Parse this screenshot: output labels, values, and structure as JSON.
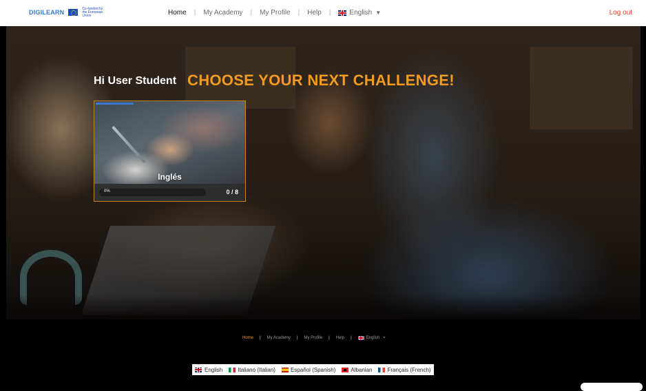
{
  "header": {
    "logo_text": "DIGILEARN",
    "eu_text": "Co-funded by the European Union",
    "nav": [
      {
        "label": "Home",
        "active": true
      },
      {
        "label": "My Academy",
        "active": false
      },
      {
        "label": "My Profile",
        "active": false
      },
      {
        "label": "Help",
        "active": false
      }
    ],
    "language": "English",
    "logout": "Log out"
  },
  "hero": {
    "greeting": "Hi User Student",
    "headline": "CHOOSE YOUR NEXT CHALLENGE!"
  },
  "course_card": {
    "title": "Inglés",
    "progress_percent_label": "0%",
    "progress_fraction": 0,
    "progress_count": "0 / 8"
  },
  "footer": {
    "nav": [
      "Home",
      "My Academy",
      "My Profile",
      "Help"
    ],
    "language": "English",
    "languages": [
      {
        "label": "English",
        "flag": "uk-flag-icon"
      },
      {
        "label": "Italiano (Italian)",
        "flag": "italy-flag-icon"
      },
      {
        "label": "Español (Spanish)",
        "flag": "spain-flag-icon"
      },
      {
        "label": "Albanian",
        "flag": "albania-flag-icon"
      },
      {
        "label": "Français (French)",
        "flag": "france-flag-icon"
      }
    ]
  },
  "colors": {
    "accent": "#f39a1f",
    "logout": "#e2461d",
    "card_border": "#c8831f"
  }
}
